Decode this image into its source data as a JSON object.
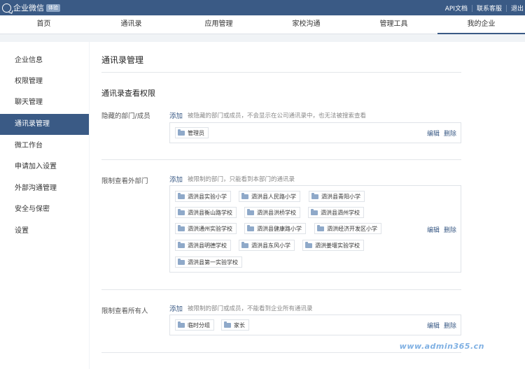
{
  "topbar": {
    "logo_text": "企业微信",
    "logo_badge": "体验",
    "links": [
      "API文档",
      "联系客服",
      "退出"
    ]
  },
  "nav": {
    "items": [
      "首页",
      "通讯录",
      "应用管理",
      "家校沟通",
      "管理工具",
      "我的企业"
    ],
    "active_index": 5
  },
  "sidebar": {
    "items": [
      "企业信息",
      "权限管理",
      "聊天管理",
      "通讯录管理",
      "微工作台",
      "申请加入设置",
      "外部沟通管理",
      "安全与保密",
      "设置"
    ],
    "active_index": 3
  },
  "main": {
    "title": "通讯录管理",
    "section_title": "通讯录查看权限",
    "rows": [
      {
        "label": "隐藏的部门/成员",
        "add_label": "添加",
        "desc": "被隐藏的部门或成员，不会显示在公司通讯录中，也无法被搜索查看",
        "tags": [
          "管理员"
        ],
        "edit_label": "编辑",
        "delete_label": "删除"
      },
      {
        "label": "限制查看外部门",
        "add_label": "添加",
        "desc": "被限制的部门，只能看到本部门的通讯录",
        "tags": [
          "泗洪县实验小学",
          "泗洪县人民路小学",
          "泗洪县青阳小学",
          "泗洪县衡山路学校",
          "泗洪县洪桥学校",
          "泗洪县泗州学校",
          "泗洪通州实验学校",
          "泗洪县健康路小学",
          "泗洪经济开发区小学",
          "泗洪县明德学校",
          "泗洪县东风小学",
          "泗洪姜堰实验学校",
          "泗洪县第一实验学校"
        ],
        "edit_label": "编辑",
        "delete_label": "删除"
      },
      {
        "label": "限制查看所有人",
        "add_label": "添加",
        "desc": "被限制的部门或成员，不能看到企业所有通讯录",
        "tags": [
          "临时分组",
          "家长"
        ],
        "edit_label": "编辑",
        "delete_label": "删除"
      }
    ]
  },
  "watermark": "www.admin365.cn",
  "colors": {
    "primary": "#3a5a85",
    "background": "#f0f3f6",
    "folder": "#8fa9c9"
  }
}
